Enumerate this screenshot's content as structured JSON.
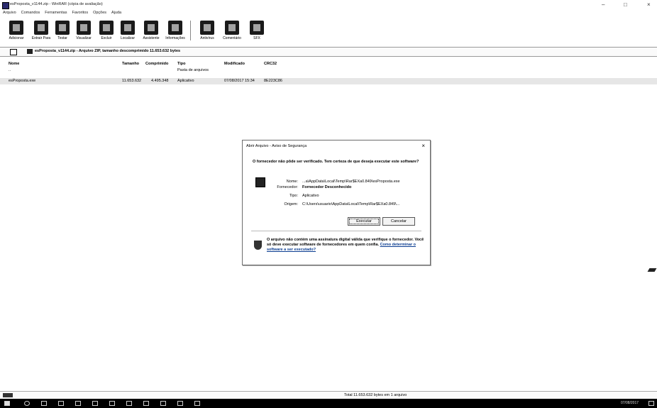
{
  "window": {
    "title": "esProposta_v1144.zip - WinRAR (cópia de avaliação)",
    "minimize": "–",
    "maximize": "□",
    "close": "×"
  },
  "menu": [
    "Arquivo",
    "Comandos",
    "Ferramentas",
    "Favoritos",
    "Opções",
    "Ajuda"
  ],
  "toolbar": [
    "Adicionar",
    "Extrair Para",
    "Testar",
    "Visualizar",
    "Excluir",
    "Localizar",
    "Assistente",
    "Informações",
    "Antivírus",
    "Comentário",
    "SFX"
  ],
  "address": {
    "text": "esProposta_v1144.zip - Arquivo ZIP, tamanho descomprimido 11.653.632 bytes"
  },
  "columns": {
    "name": "Nome",
    "size": "Tamanho",
    "packed": "Comprimido",
    "type": "Tipo",
    "modified": "Modificado",
    "crc": "CRC32"
  },
  "rows": [
    {
      "name": "..",
      "size": "",
      "packed": "",
      "type": "Pasta de arquivos",
      "modified": "",
      "crc": ""
    },
    {
      "name": "esProposta.exe",
      "size": "11.653.632",
      "packed": "4.495.348",
      "type": "Aplicativo",
      "modified": "07/08/2017 15:34",
      "crc": "8E223C86"
    }
  ],
  "dialog": {
    "title": "Abrir Arquivo - Aviso de Segurança",
    "close": "×",
    "question": "O fornecedor não pôde ser verificado. Tem certeza de que deseja executar este software?",
    "name_label": "Nome:",
    "name_value": "...a\\AppData\\Local\\Temp\\Rar$EXa0.849\\esProposta.exe",
    "publisher_label": "Fornecedor:",
    "publisher_value": "Fornecedor Desconhecido",
    "type_label": "Tipo:",
    "type_value": "Aplicativo",
    "origin_label": "Origem:",
    "origin_value": "C:\\Users\\usuario\\AppData\\Local\\Temp\\Rar$EXa0.849\\...",
    "execute": "Executar",
    "cancel": "Cancelar",
    "warning": "O arquivo não contém uma assinatura digital válida que verifique o fornecedor. Você só deve executar software de fornecedores em quem confia.",
    "link": "Como determinar o software a ser executado?"
  },
  "status": {
    "text": "Total 11.653.632 bytes em 1 arquivo"
  },
  "tray": {
    "date": "07/08/2017"
  }
}
